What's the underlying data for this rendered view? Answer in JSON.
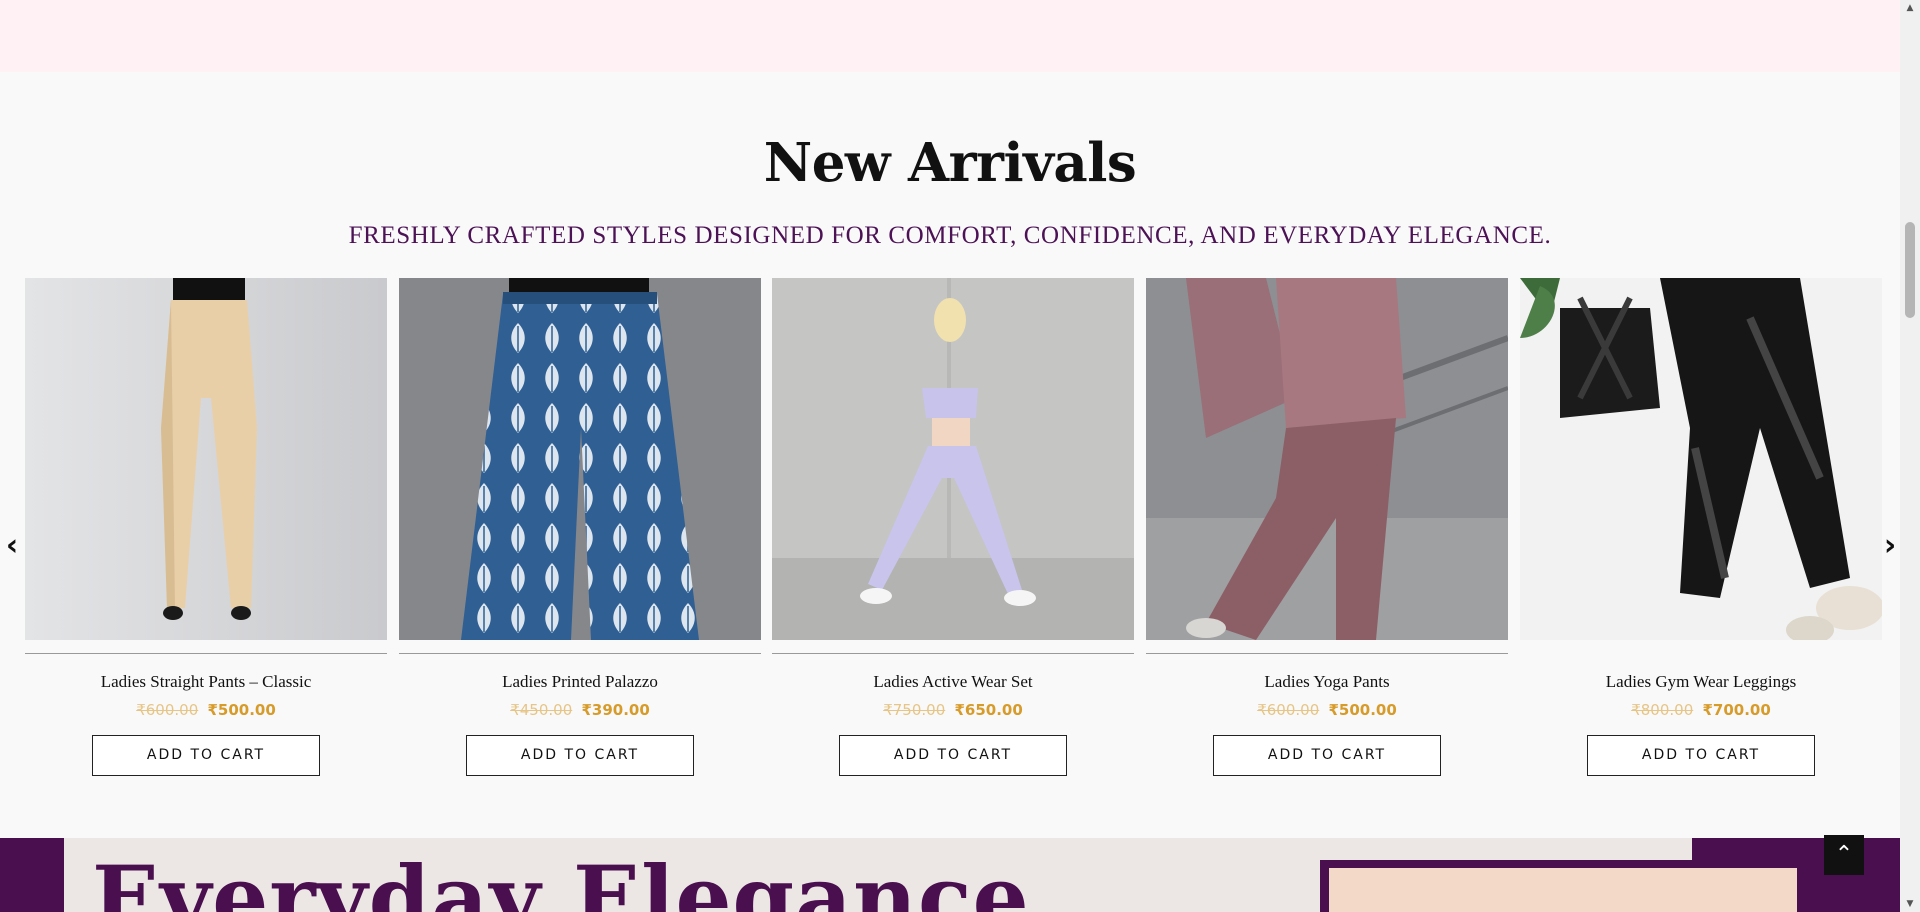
{
  "section": {
    "title": "New Arrivals",
    "subtitle": "FRESHLY CRAFTED STYLES DESIGNED FOR COMFORT, CONFIDENCE, AND EVERYDAY ELEGANCE."
  },
  "carousel": {
    "prev_icon": "chevron-left-icon",
    "next_icon": "chevron-right-icon",
    "prev_glyph": "‹",
    "next_glyph": "›"
  },
  "products": [
    {
      "name": "Ladies Straight Pants – Classic",
      "old_price": "₹600.00",
      "price": "₹500.00",
      "cta": "ADD TO CART"
    },
    {
      "name": "Ladies Printed Palazzo",
      "old_price": "₹450.00",
      "price": "₹390.00",
      "cta": "ADD TO CART"
    },
    {
      "name": "Ladies Active Wear Set",
      "old_price": "₹750.00",
      "price": "₹650.00",
      "cta": "ADD TO CART"
    },
    {
      "name": "Ladies Yoga Pants",
      "old_price": "₹600.00",
      "price": "₹500.00",
      "cta": "ADD TO CART"
    },
    {
      "name": "Ladies Gym Wear Leggings",
      "old_price": "₹800.00",
      "price": "₹700.00",
      "cta": "ADD TO CART"
    }
  ],
  "banner": {
    "headline": "Everyday Elegance"
  },
  "back_to_top": {
    "icon": "chevron-up-icon",
    "glyph": "⌃"
  },
  "colors": {
    "accent_purple": "#4a0f4e",
    "price_gold": "#d79b2a",
    "top_band": "#fff1f4"
  }
}
